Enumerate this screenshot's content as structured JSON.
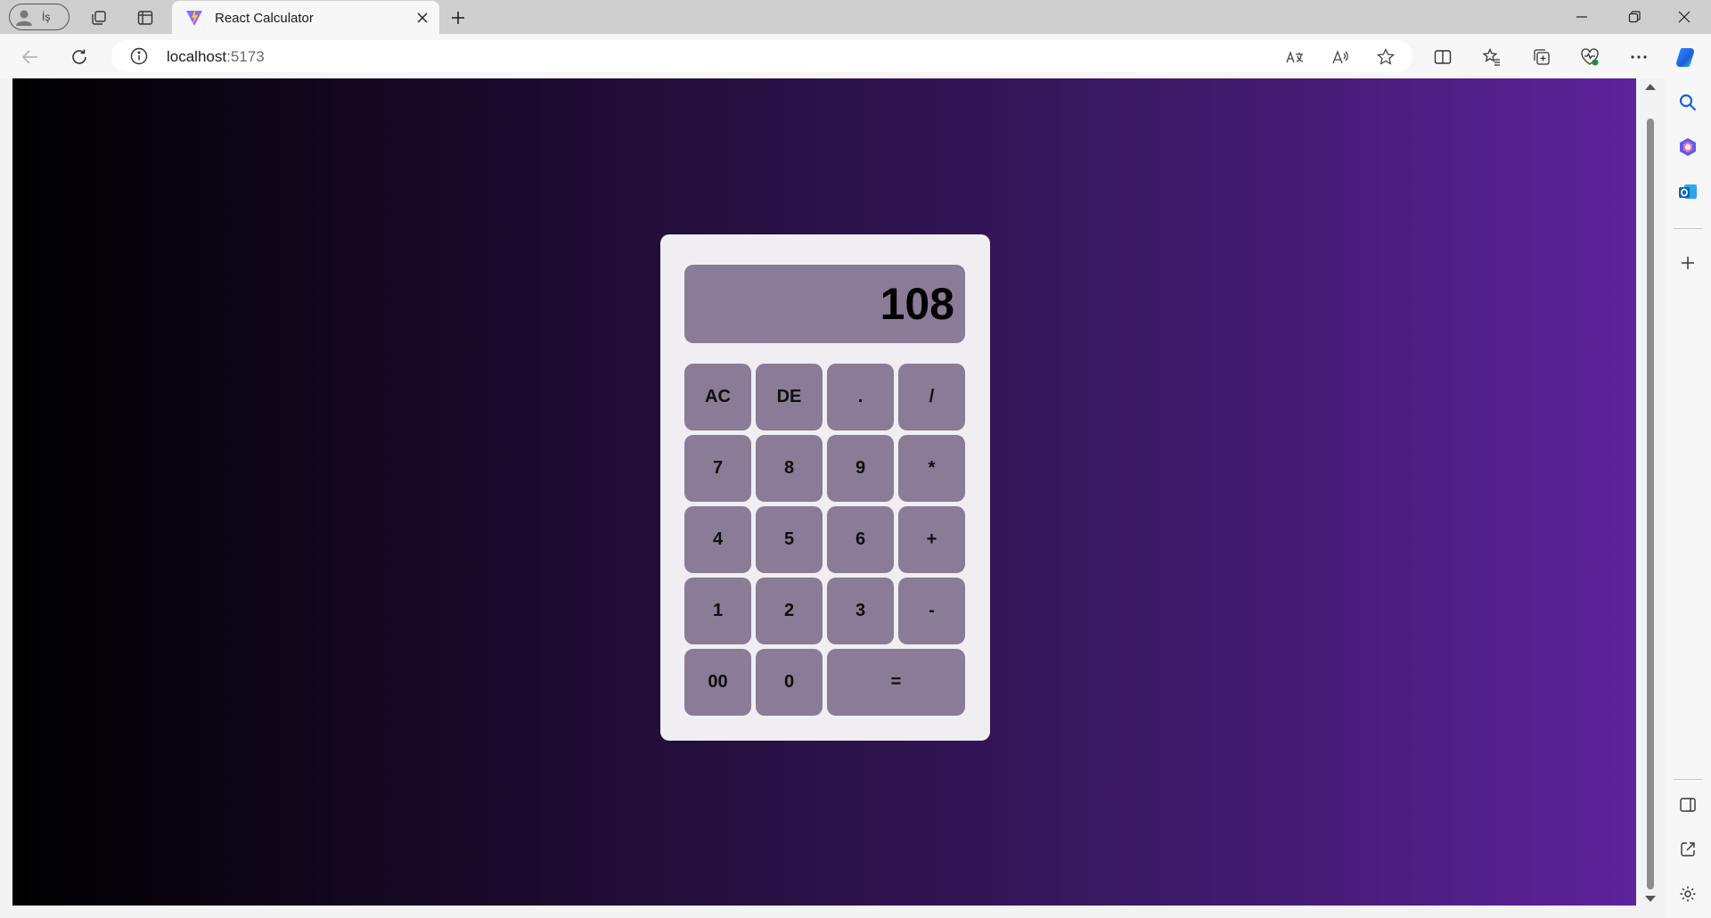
{
  "browser": {
    "profile_label": "İş",
    "tab_title": "React Calculator",
    "url_host": "localhost",
    "url_port": ":5173",
    "icons": [
      "profile-icon",
      "workspaces-icon",
      "vertical-tabs-icon",
      "vite-logo-icon",
      "close-icon",
      "plus-icon",
      "minimize-icon",
      "restore-icon",
      "window-close-icon",
      "back-icon",
      "refresh-icon",
      "info-icon",
      "translate-icon",
      "read-aloud-icon",
      "favorite-star-icon",
      "split-screen-icon",
      "favorites-icon",
      "collections-icon",
      "browser-essentials-icon",
      "more-icon",
      "copilot-icon"
    ]
  },
  "sidebar": {
    "icons": [
      "search-icon",
      "copilot-apps-icon",
      "outlook-icon",
      "add-icon",
      "sidebar-toggle-icon",
      "open-external-icon",
      "settings-icon"
    ]
  },
  "calculator": {
    "display_value": "108",
    "keys": [
      {
        "label": "AC"
      },
      {
        "label": "DE"
      },
      {
        "label": "."
      },
      {
        "label": "/"
      },
      {
        "label": "7"
      },
      {
        "label": "8"
      },
      {
        "label": "9"
      },
      {
        "label": "*"
      },
      {
        "label": "4"
      },
      {
        "label": "5"
      },
      {
        "label": "6"
      },
      {
        "label": "+"
      },
      {
        "label": "1"
      },
      {
        "label": "2"
      },
      {
        "label": "3"
      },
      {
        "label": "-"
      },
      {
        "label": "00"
      },
      {
        "label": "0"
      },
      {
        "label": "=",
        "wide": true
      }
    ],
    "colors": {
      "panel": "#f1eef3",
      "key": "#8a7b96",
      "gradient_start": "#000000",
      "gradient_end": "#5d239b"
    }
  }
}
